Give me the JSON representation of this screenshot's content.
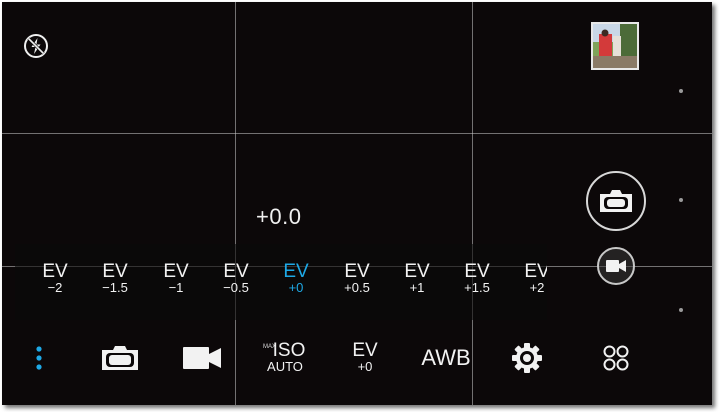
{
  "viewfinder": {
    "ev_readout": "+0.0"
  },
  "ev_scale": {
    "items": [
      {
        "label": "EV",
        "value": "−2"
      },
      {
        "label": "EV",
        "value": "−1.5"
      },
      {
        "label": "EV",
        "value": "−1"
      },
      {
        "label": "EV",
        "value": "−0.5"
      },
      {
        "label": "EV",
        "value": "+0"
      },
      {
        "label": "EV",
        "value": "+0.5"
      },
      {
        "label": "EV",
        "value": "+1"
      },
      {
        "label": "EV",
        "value": "+1.5"
      },
      {
        "label": "EV",
        "value": "+2"
      }
    ],
    "selected_value": "+0",
    "accent_color": "#1ea9e6"
  },
  "toolbar": {
    "iso_max_label": "MAX",
    "iso_label": "ISO",
    "iso_value": "AUTO",
    "ev_label": "EV",
    "ev_value": "+0",
    "awb_label": "AWB"
  },
  "icons": {
    "flash": "flash-off-icon",
    "menu": "more-vertical-icon",
    "photo": "camera-icon",
    "video": "video-camera-icon",
    "settings": "gear-icon",
    "modes": "mode-grid-icon"
  }
}
